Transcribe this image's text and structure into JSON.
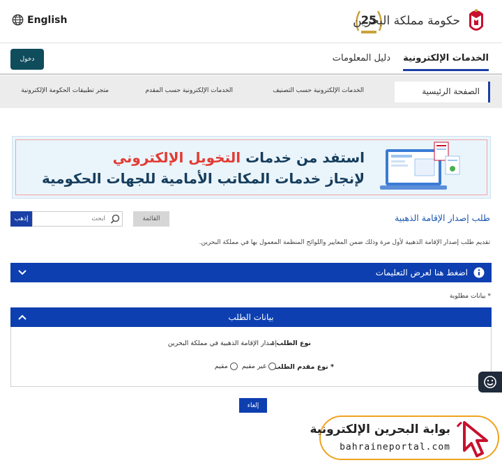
{
  "header": {
    "language": "English",
    "gov_name": "حكومة مملكة البحرين",
    "anniversary": "25"
  },
  "nav": {
    "login": "دخول",
    "tabs": [
      {
        "label": "الخدمات الإلكترونية",
        "active": true
      },
      {
        "label": "دليل المعلومات",
        "active": false
      }
    ]
  },
  "subnav": {
    "items": [
      "الصفحة الرئيسية",
      "الخدمات الإلكترونية حسب التصنيف",
      "الخدمات الإلكترونية حسب المقدم",
      "متجر تطبيقات الحكومة الإلكترونية"
    ]
  },
  "banner": {
    "line1_start": "استفد من خدمات ",
    "line1_highlight": "التخويل الإلكتروني",
    "line2": "لإنجاز خدمات المكاتب الأمامية للجهات الحكومية"
  },
  "page": {
    "title": "طلب إصدار الإقامة الذهبية",
    "list_button": "القائمة",
    "search_placeholder": "ابحث",
    "go_button": "إذهب",
    "description": "تقديم طلب إصدار الإقامة الذهبية لأول مرة وذلك ضمن المعايير واللوائح المنظمة المعمول بها في مملكة البحرين.",
    "instructions": "اضغط هنا لعرض التعليمات",
    "required_note": "* بيانات مطلوبة",
    "cancel": "إلغاء"
  },
  "request_panel": {
    "title": "بيانات الطلب",
    "request_type_label": "نوع الطلب :",
    "request_type_value": "إصدار الإقامة الذهبية في مملكة البحرين",
    "applicant_type_label": "* نوع مقدم الطلب :",
    "applicant_options": [
      "غير مقيم",
      "مقيم"
    ]
  },
  "watermark": {
    "title": "بوابة البحرين الإلكترونية",
    "url": "bahraineportal.com"
  },
  "colors": {
    "primary_blue": "#0d3fb0",
    "login_teal": "#0f4c5c",
    "highlight_red": "#e23b33",
    "watermark_orange": "#f0a21e"
  }
}
